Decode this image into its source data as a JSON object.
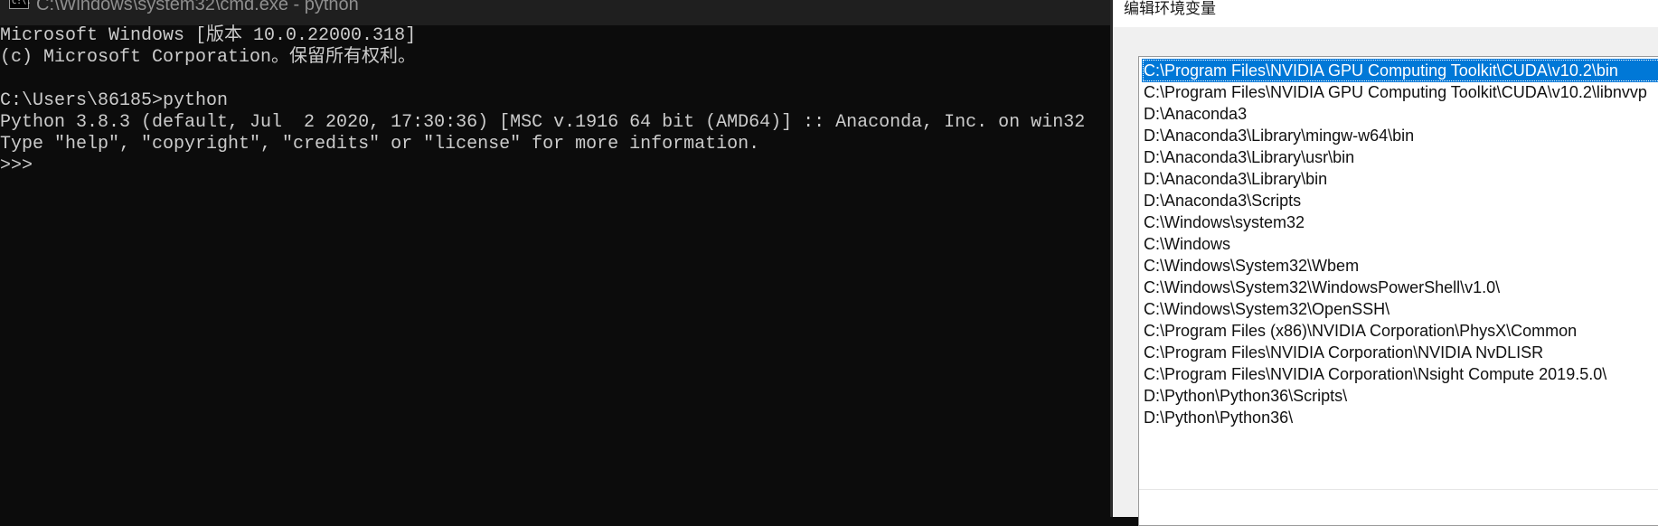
{
  "cmd": {
    "icon_text": "C:\\.",
    "title": "C:\\Windows\\system32\\cmd.exe - python",
    "lines": [
      "Microsoft Windows [版本 10.0.22000.318]",
      "(c) Microsoft Corporation。保留所有权利。",
      "",
      "C:\\Users\\86185>python",
      "Python 3.8.3 (default, Jul  2 2020, 17:30:36) [MSC v.1916 64 bit (AMD64)] :: Anaconda, Inc. on win32",
      "Type \"help\", \"copyright\", \"credits\" or \"license\" for more information.",
      ">>> "
    ]
  },
  "dialog": {
    "title": "编辑环境变量",
    "selected_index": 0,
    "paths": [
      "C:\\Program Files\\NVIDIA GPU Computing Toolkit\\CUDA\\v10.2\\bin",
      "C:\\Program Files\\NVIDIA GPU Computing Toolkit\\CUDA\\v10.2\\libnvvp",
      "D:\\Anaconda3",
      "D:\\Anaconda3\\Library\\mingw-w64\\bin",
      "D:\\Anaconda3\\Library\\usr\\bin",
      "D:\\Anaconda3\\Library\\bin",
      "D:\\Anaconda3\\Scripts",
      "C:\\Windows\\system32",
      "C:\\Windows",
      "C:\\Windows\\System32\\Wbem",
      "C:\\Windows\\System32\\WindowsPowerShell\\v1.0\\",
      "C:\\Windows\\System32\\OpenSSH\\",
      "C:\\Program Files (x86)\\NVIDIA Corporation\\PhysX\\Common",
      "C:\\Program Files\\NVIDIA Corporation\\NVIDIA NvDLISR",
      "C:\\Program Files\\NVIDIA Corporation\\Nsight Compute 2019.5.0\\",
      "D:\\Python\\Python36\\Scripts\\",
      "D:\\Python\\Python36\\"
    ]
  }
}
